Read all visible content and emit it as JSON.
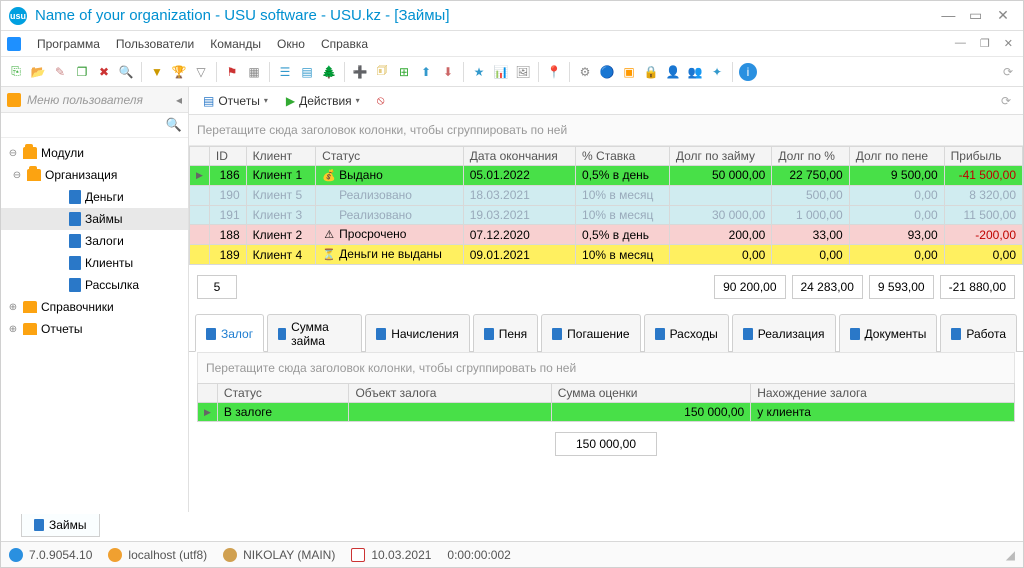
{
  "title": "Name of your organization - USU software - USU.kz - [Займы]",
  "menus": [
    "Программа",
    "Пользователи",
    "Команды",
    "Окно",
    "Справка"
  ],
  "sidebar": {
    "header": "Меню пользователя",
    "nodes": {
      "modules": "Модули",
      "organization": "Организация",
      "money": "Деньги",
      "loans": "Займы",
      "pledges": "Залоги",
      "clients": "Клиенты",
      "mailing": "Рассылка",
      "refs": "Справочники",
      "reports": "Отчеты"
    }
  },
  "content_toolbar": {
    "reports": "Отчеты",
    "actions": "Действия"
  },
  "group_hint": "Перетащите сюда заголовок колонки, чтобы сгруппировать по ней",
  "columns": [
    "ID",
    "Клиент",
    "Статус",
    "Дата окончания",
    "% Ставка",
    "Долг по займу",
    "Долг по %",
    "Долг по пене",
    "Прибыль"
  ],
  "rows": [
    {
      "cls": "lime",
      "sel": "▶",
      "id": "186",
      "client": "Клиент 1",
      "status_ico": "💰",
      "status": "Выдано",
      "date": "05.01.2022",
      "rate": "0,5% в день",
      "d1": "50 000,00",
      "d2": "22 750,00",
      "d3": "9 500,00",
      "profit": "-41 500,00"
    },
    {
      "cls": "lightblue",
      "sel": "",
      "id": "190",
      "client": "Клиент 5",
      "status_ico": "",
      "status": "Реализовано",
      "date": "18.03.2021",
      "rate": "10% в месяц",
      "d1": "",
      "d2": "500,00",
      "d3": "0,00",
      "profit": "8 320,00"
    },
    {
      "cls": "lightblue",
      "sel": "",
      "id": "191",
      "client": "Клиент 3",
      "status_ico": "",
      "status": "Реализовано",
      "date": "19.03.2021",
      "rate": "10% в месяц",
      "d1": "30 000,00",
      "d2": "1 000,00",
      "d3": "0,00",
      "profit": "11 500,00"
    },
    {
      "cls": "pink",
      "sel": "",
      "id": "188",
      "client": "Клиент 2",
      "status_ico": "⚠",
      "status": "Просрочено",
      "date": "07.12.2020",
      "rate": "0,5% в день",
      "d1": "200,00",
      "d2": "33,00",
      "d3": "93,00",
      "profit": "-200,00"
    },
    {
      "cls": "yellow",
      "sel": "",
      "id": "189",
      "client": "Клиент 4",
      "status_ico": "⏳",
      "status": "Деньги не выданы",
      "date": "09.01.2021",
      "rate": "10% в месяц",
      "d1": "0,00",
      "d2": "0,00",
      "d3": "0,00",
      "profit": "0,00"
    }
  ],
  "totals": {
    "count": "5",
    "d1": "90 200,00",
    "d2": "24 283,00",
    "d3": "9 593,00",
    "profit": "-21 880,00"
  },
  "tabs": [
    "Залог",
    "Сумма займа",
    "Начисления",
    "Пеня",
    "Погашение",
    "Расходы",
    "Реализация",
    "Документы",
    "Работа"
  ],
  "sub_columns": [
    "Статус",
    "Объект залога",
    "Сумма оценки",
    "Нахождение залога"
  ],
  "sub_row": {
    "status": "В залоге",
    "object": "",
    "val": "150 000,00",
    "loc": "у клиента"
  },
  "sub_total": "150 000,00",
  "bottom_tab": "Займы",
  "status": {
    "ver": "7.0.9054.10",
    "host": "localhost (utf8)",
    "user": "NIKOLAY (MAIN)",
    "date": "10.03.2021",
    "time": "0:00:00:002"
  }
}
